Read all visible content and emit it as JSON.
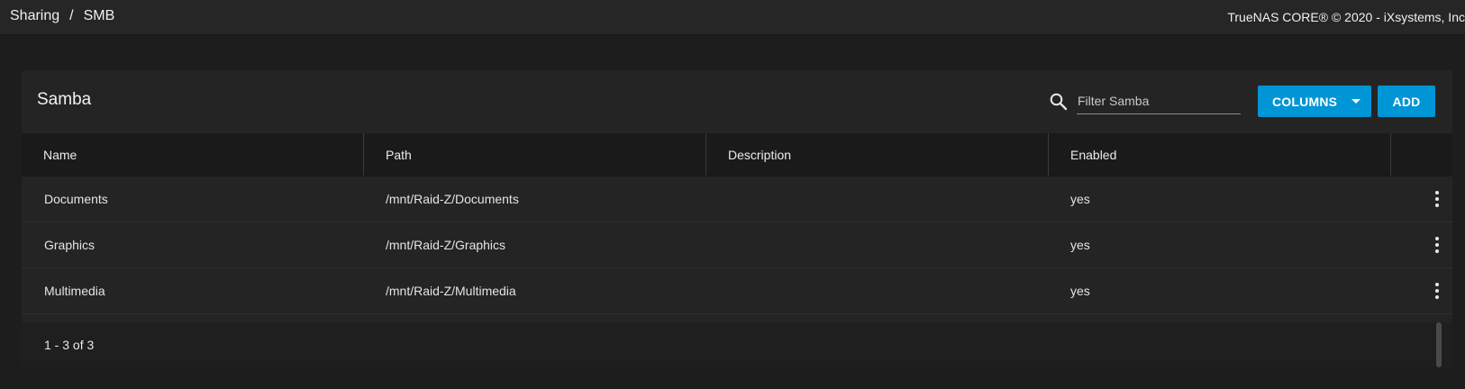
{
  "topbar": {
    "breadcrumb": [
      "Sharing",
      "SMB"
    ],
    "breadcrumb_separator": "/",
    "copyright": "TrueNAS CORE® © 2020 - iXsystems, Inc"
  },
  "card": {
    "title": "Samba",
    "search": {
      "placeholder": "Filter Samba",
      "value": "",
      "icon": "search-icon"
    },
    "columns_button": "COLUMNS",
    "add_button": "ADD"
  },
  "table": {
    "headers": [
      "Name",
      "Path",
      "Description",
      "Enabled"
    ],
    "rows": [
      {
        "name": "Documents",
        "path": "/mnt/Raid-Z/Documents",
        "description": "",
        "enabled": "yes"
      },
      {
        "name": "Graphics",
        "path": "/mnt/Raid-Z/Graphics",
        "description": "",
        "enabled": "yes"
      },
      {
        "name": "Multimedia",
        "path": "/mnt/Raid-Z/Multimedia",
        "description": "",
        "enabled": "yes"
      }
    ]
  },
  "paginator": {
    "range": "1 - 3 of 3"
  },
  "colors": {
    "accent": "#0095d5",
    "background": "#1d1d1d",
    "card": "#242424",
    "header": "#1a1a1a"
  }
}
